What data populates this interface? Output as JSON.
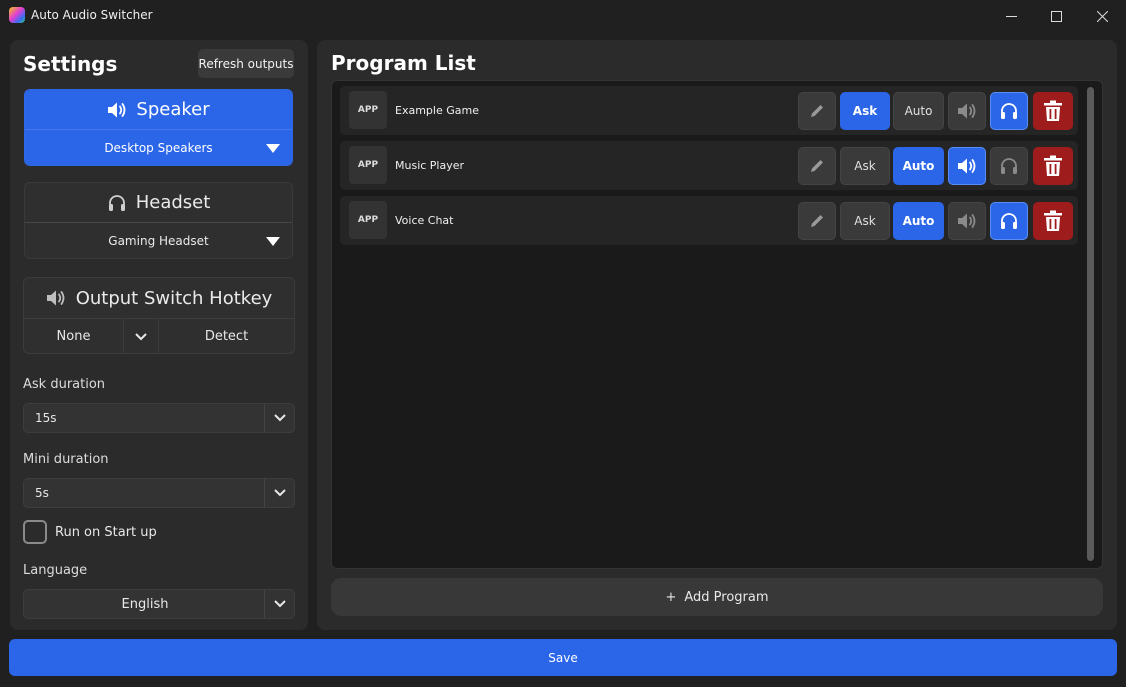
{
  "window": {
    "title": "Auto Audio Switcher"
  },
  "settings": {
    "heading": "Settings",
    "refresh_label": "Refresh outputs",
    "speaker": {
      "title": "Speaker",
      "device": "Desktop Speakers"
    },
    "headset": {
      "title": "Headset",
      "device": "Gaming Headset"
    },
    "hotkey": {
      "title": "Output Switch Hotkey",
      "value": "None",
      "detect_label": "Detect"
    },
    "ask_duration": {
      "label": "Ask duration",
      "value": "15s"
    },
    "mini_duration": {
      "label": "Mini duration",
      "value": "5s"
    },
    "run_on_startup": {
      "label": "Run on Start up",
      "checked": false
    },
    "language": {
      "label": "Language",
      "value": "English"
    }
  },
  "program_list": {
    "heading": "Program List",
    "app_badge": "APP",
    "ask_label": "Ask",
    "auto_label": "Auto",
    "programs": [
      {
        "name": "Example Game",
        "mode": "Ask",
        "output": "headset"
      },
      {
        "name": "Music Player",
        "mode": "Auto",
        "output": "speaker"
      },
      {
        "name": "Voice Chat",
        "mode": "Auto",
        "output": "headset"
      }
    ],
    "add_label": "Add Program",
    "add_icon": "+"
  },
  "save_label": "Save",
  "colors": {
    "accent": "#2b66e8",
    "danger": "#9e1c1c",
    "panel": "#2b2b2b",
    "background": "#202020"
  },
  "icons": [
    "app-logo",
    "minimize-icon",
    "maximize-icon",
    "close-icon",
    "speaker-icon",
    "headphones-icon",
    "chevron-down-icon",
    "pencil-icon",
    "trash-icon",
    "plus-icon"
  ]
}
